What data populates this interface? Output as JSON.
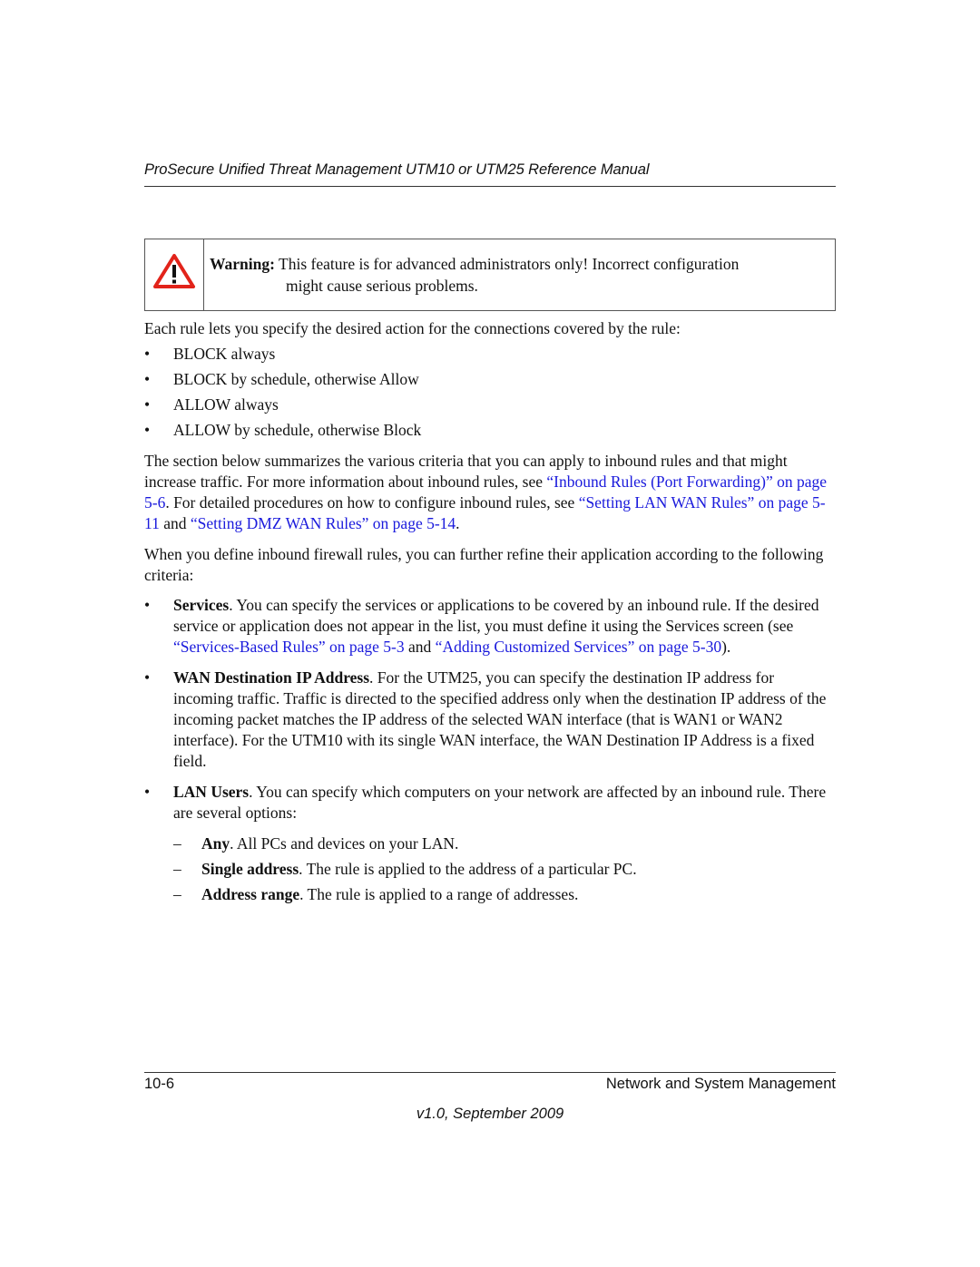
{
  "header": {
    "title": "ProSecure Unified Threat Management UTM10 or UTM25 Reference Manual"
  },
  "warning": {
    "icon": "warning-triangle-icon",
    "label": "Warning:",
    "line1": " This feature is for advanced administrators only! Incorrect configuration",
    "line2": "might cause serious problems."
  },
  "intro": "Each rule lets you specify the desired action for the connections covered by the rule:",
  "actions": [
    "BLOCK always",
    "BLOCK by schedule, otherwise Allow",
    "ALLOW always",
    "ALLOW by schedule, otherwise Block"
  ],
  "summary": {
    "t1": "The section below summarizes the various criteria that you can apply to inbound rules and that might increase traffic. For more information about inbound rules, see ",
    "link1": "“Inbound Rules (Port Forwarding)” on page 5-6",
    "t2": ". For detailed procedures on how to configure inbound rules, see ",
    "link2": "“Setting LAN WAN Rules” on page 5-11",
    "t3": " and ",
    "link3": "“Setting DMZ WAN Rules” on page 5-14",
    "t4": "."
  },
  "refine": "When you define inbound firewall rules, you can further refine their application according to the following criteria:",
  "criteria": {
    "services": {
      "term": "Services",
      "t1": ". You can specify the services or applications to be covered by an inbound rule. If the desired service or application does not appear in the list, you must define it using the Services screen (see ",
      "link1": "“Services-Based Rules” on page 5-3",
      "t2": " and ",
      "link2": "“Adding Customized Services” on page 5-30",
      "t3": ")."
    },
    "wan": {
      "term": "WAN Destination IP Address",
      "text": ". For the UTM25, you can specify the destination IP address for incoming traffic. Traffic is directed to the specified address only when the destination IP address of the incoming packet matches the IP address of the selected WAN interface (that is WAN1 or WAN2 interface). For the UTM10 with its single WAN interface, the WAN Destination IP Address is a fixed field."
    },
    "lan": {
      "term": "LAN Users",
      "text": ". You can specify which computers on your network are affected by an inbound rule. There are several options:",
      "options": [
        {
          "term": "Any",
          "text": ". All PCs and devices on your LAN."
        },
        {
          "term": "Single address",
          "text": ". The rule is applied to the address of a particular PC."
        },
        {
          "term": "Address range",
          "text": ". The rule is applied to a range of addresses."
        }
      ]
    }
  },
  "bullet_char": "•",
  "dash_char": "–",
  "footer": {
    "page": "10-6",
    "section": "Network and System Management",
    "version": "v1.0, September 2009"
  }
}
